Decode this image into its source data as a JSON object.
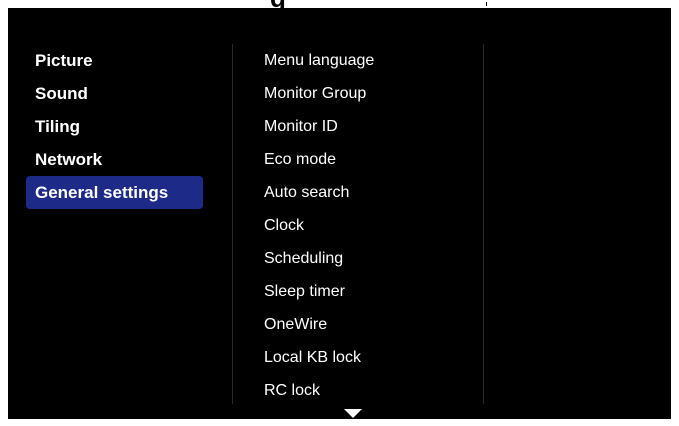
{
  "header": {
    "title_fragment": "g"
  },
  "left_menu": {
    "items": [
      {
        "label": "Picture",
        "active": false
      },
      {
        "label": "Sound",
        "active": false
      },
      {
        "label": "Tiling",
        "active": false
      },
      {
        "label": "Network",
        "active": false
      },
      {
        "label": "General settings",
        "active": true
      }
    ]
  },
  "right_menu": {
    "items": [
      {
        "label": "Menu language"
      },
      {
        "label": "Monitor Group"
      },
      {
        "label": "Monitor ID"
      },
      {
        "label": "Eco mode"
      },
      {
        "label": "Auto search"
      },
      {
        "label": "Clock"
      },
      {
        "label": "Scheduling"
      },
      {
        "label": "Sleep timer"
      },
      {
        "label": "OneWire"
      },
      {
        "label": "Local KB lock"
      },
      {
        "label": "RC lock"
      }
    ]
  },
  "scroll": {
    "down_icon": "triangle-down-icon"
  },
  "colors": {
    "background": "#000000",
    "highlight": "#1e2a88",
    "text": "#ffffff"
  }
}
